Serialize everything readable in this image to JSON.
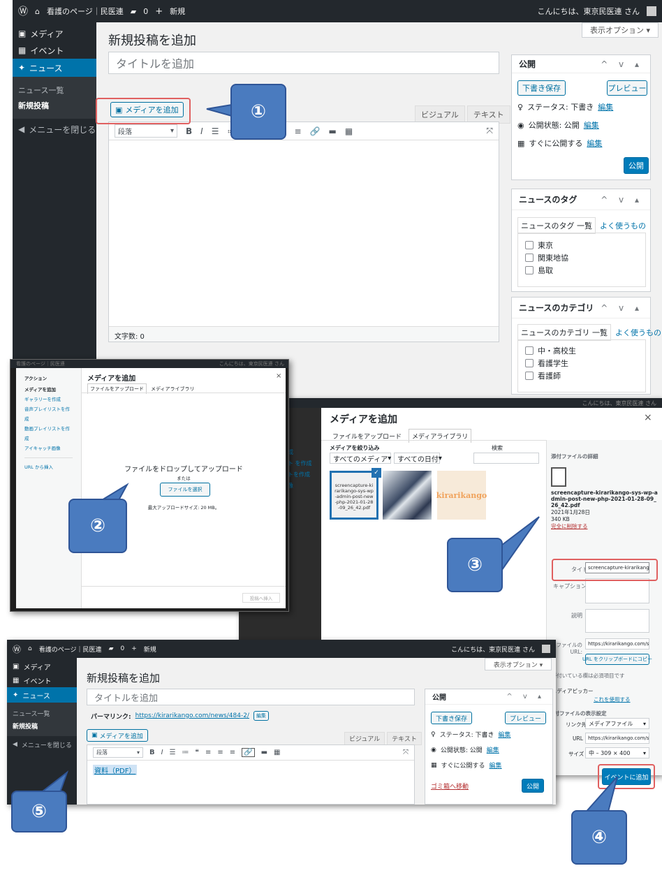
{
  "s1": {
    "bar": {
      "site": "看護のページ｜民医連",
      "comments": "0",
      "new": "新規",
      "greeting": "こんにちは、東京民医連 さん"
    },
    "menu": {
      "media": "メディア",
      "events": "イベント",
      "news": "ニュース",
      "sub_list": "ニュース一覧",
      "sub_new": "新規投稿",
      "close": "メニューを閉じる"
    },
    "screen_options": "表示オプション ▾",
    "heading": "新規投稿を追加",
    "title_placeholder": "タイトルを追加",
    "add_media": "メディアを追加",
    "tab_visual": "ビジュアル",
    "tab_text": "テキスト",
    "format_select": "段落",
    "word_count": "文字数: 0",
    "publish": {
      "title": "公開",
      "save_draft": "下書き保存",
      "preview": "プレビュー",
      "status": "ステータス: 下書き",
      "edit": "編集",
      "visibility": "公開状態: 公開",
      "schedule": "すぐに公開する",
      "publish_btn": "公開"
    },
    "tags": {
      "title": "ニュースのタグ",
      "tab_all": "ニュースのタグ 一覧",
      "tab_popular": "よく使うもの",
      "items": [
        "東京",
        "関東地協",
        "島取"
      ]
    },
    "cats": {
      "title": "ニュースのカテゴリ",
      "tab_all": "ニュースのカテゴリ 一覧",
      "tab_popular": "よく使うもの",
      "items": [
        "中・高校生",
        "看護学生",
        "看護師"
      ]
    }
  },
  "s2": {
    "title": "メディアを追加",
    "close": "×",
    "tab_upload": "ファイルをアップロード",
    "tab_library": "メディアライブラリ",
    "actions": "アクション",
    "menu": [
      "メディアを追加",
      "ギャラリーを作成",
      "音声プレイリストを作成",
      "動画プレイリストを作成",
      "アイキャッチ画像",
      "URL から挿入"
    ],
    "drop": "ファイルをドロップしてアップロード",
    "or": "または",
    "select": "ファイルを選択",
    "max": "最大アップロードサイズ: 20 MB。",
    "insert": "投稿へ挿入"
  },
  "s3": {
    "title": "メディアを追加",
    "close": "×",
    "tab_upload": "ファイルをアップロード",
    "tab_library": "メディアライブラリ",
    "filter_label": "メディアを絞り込み",
    "filter_type": "すべてのメディア",
    "filter_date": "すべての日付",
    "search_label": "検索",
    "thumb_pdf": "screencapture-kirarikango-sys-wp-admin-post-new-php-2021-01-28-09_26_42.pdf",
    "thumb_logo": "kirarikango",
    "side_menu": [
      "作成",
      "スト を作成",
      "ストを作成",
      "画像"
    ],
    "details_title": "添付ファイルの詳細",
    "file_name": "screencapture-kirarikango-sys-wp-admin-post-new-php-2021-01-28-09_26_42.pdf",
    "date": "2021年1月28日",
    "size": "340 KB",
    "delete": "完全に削除する",
    "label_title": "タイトル",
    "title_value": "screencapture-kirarikango-",
    "label_caption": "キャプション",
    "label_desc": "説明",
    "label_url": "ファイルの URL:",
    "url_value": "https://kirarikango.com/sys",
    "copy_btn": "URL をクリップボードにコピー",
    "required": "*が付いている欄は必須項目です",
    "picker": "メディアピッカー",
    "picker_link": "これを使用する",
    "display": "添付ファイルの表示設定",
    "link_to_label": "リンク先",
    "link_to": "メディアファイル",
    "url_label": "URL",
    "url2": "https://kirarikango.com/sys",
    "size_label": "サイズ",
    "size_value": "中 – 309 × 400",
    "insert_btn": "イベントに追加"
  },
  "s4": {
    "bar": {
      "site": "看護のページ｜民医連",
      "comments": "0",
      "new": "新規",
      "greeting": "こんにちは、東京民医連 さん"
    },
    "menu": {
      "media": "メディア",
      "events": "イベント",
      "news": "ニュース",
      "sub_list": "ニュース一覧",
      "sub_new": "新規投稿",
      "close": "メニューを閉じる"
    },
    "screen_options": "表示オプション ▾",
    "heading": "新規投稿を追加",
    "title_placeholder": "タイトルを追加",
    "permalink_label": "パーマリンク:",
    "permalink": "https://kirarikango.com/news/484-2/",
    "permalink_edit": "編集",
    "add_media": "メディアを追加",
    "tab_visual": "ビジュアル",
    "tab_text": "テキスト",
    "format_select": "段落",
    "content_link": "資料（PDF）",
    "publish": {
      "title": "公開",
      "save_draft": "下書き保存",
      "preview": "プレビュー",
      "status": "ステータス: 下書き",
      "edit": "編集",
      "visibility": "公開状態: 公開",
      "schedule": "すぐに公開する",
      "trash": "ゴミ箱へ移動",
      "publish_btn": "公開"
    }
  },
  "callouts": {
    "c1": "①",
    "c2": "②",
    "c3": "③",
    "c4": "④",
    "c5": "⑤"
  },
  "colors": {
    "wp_dark": "#23282d",
    "wp_blue": "#0073aa",
    "callout": "#4a7bbf",
    "highlight": "#e06060"
  }
}
